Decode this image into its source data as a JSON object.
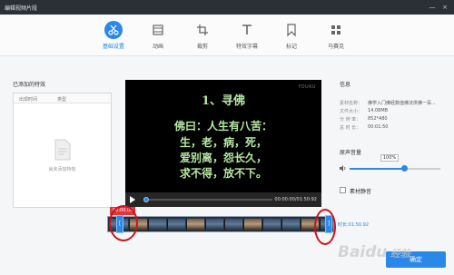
{
  "window": {
    "title": "编辑视频片段",
    "minimize": "—",
    "close": "×"
  },
  "toolbar": {
    "tools": [
      {
        "label": "基础设置",
        "icon": "scissors-icon",
        "active": true
      },
      {
        "label": "动画",
        "icon": "film-icon"
      },
      {
        "label": "裁剪",
        "icon": "crop-icon"
      },
      {
        "label": "特效字幕",
        "icon": "text-icon"
      },
      {
        "label": "标记",
        "icon": "bookmark-icon"
      },
      {
        "label": "马赛克",
        "icon": "mosaic-icon"
      }
    ]
  },
  "effects": {
    "title": "已添加的特效",
    "col_time": "出现时间",
    "col_type": "类型",
    "empty_text": "尚未添加特效"
  },
  "player": {
    "watermark": "YOUKU",
    "subtitles": [
      "1、寻佛",
      "佛曰：人生有八苦：",
      "生，老，病，死，",
      "爱别离，怨长久，",
      "求不得，放不下。"
    ],
    "time_display": "00:00:00/01:50:92",
    "progress": 0.0
  },
  "info": {
    "title": "信息",
    "rows": [
      {
        "key": "素材名称：",
        "value": "佛学入门佛经数值佛法供佛一百..."
      },
      {
        "key": "文件大小：",
        "value": "14.08MB"
      },
      {
        "key": "分 辨 率：",
        "value": "852*480"
      },
      {
        "key": "总 时 长：",
        "value": "00:01:50"
      }
    ]
  },
  "volume": {
    "title": "原声音量",
    "tooltip": "100%",
    "level": 0.6
  },
  "mute": {
    "label": "素材静音"
  },
  "timeline": {
    "start_time": "00:00.00",
    "end_time": "时长:01:50.92"
  },
  "buttons": {
    "confirm": "确定"
  },
  "watermark_text": "Baidu经验",
  "colors": {
    "accent": "#2a88e8",
    "annotation": "#c9141b",
    "subtitle": "#b6e7a4"
  }
}
